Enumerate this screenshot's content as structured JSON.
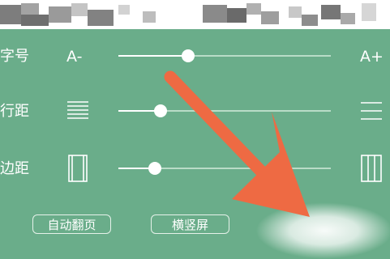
{
  "settings": {
    "font_size": {
      "label": "字号",
      "min_label": "A-",
      "max_label": "A+",
      "value": 0.33
    },
    "line_spacing": {
      "label": "行距",
      "min_icon": "dense-lines-icon",
      "max_icon": "sparse-lines-icon",
      "value": 0.2
    },
    "margin": {
      "label": "边距",
      "min_icon": "narrow-margin-icon",
      "max_icon": "wide-margin-icon",
      "value": 0.17
    }
  },
  "buttons": {
    "auto_page_turn": "自动翻页",
    "orientation": "横竖屏"
  },
  "colors": {
    "panel_bg": "#6aad8a",
    "arrow": "#ee6a43",
    "track": "#b9dcc7"
  }
}
